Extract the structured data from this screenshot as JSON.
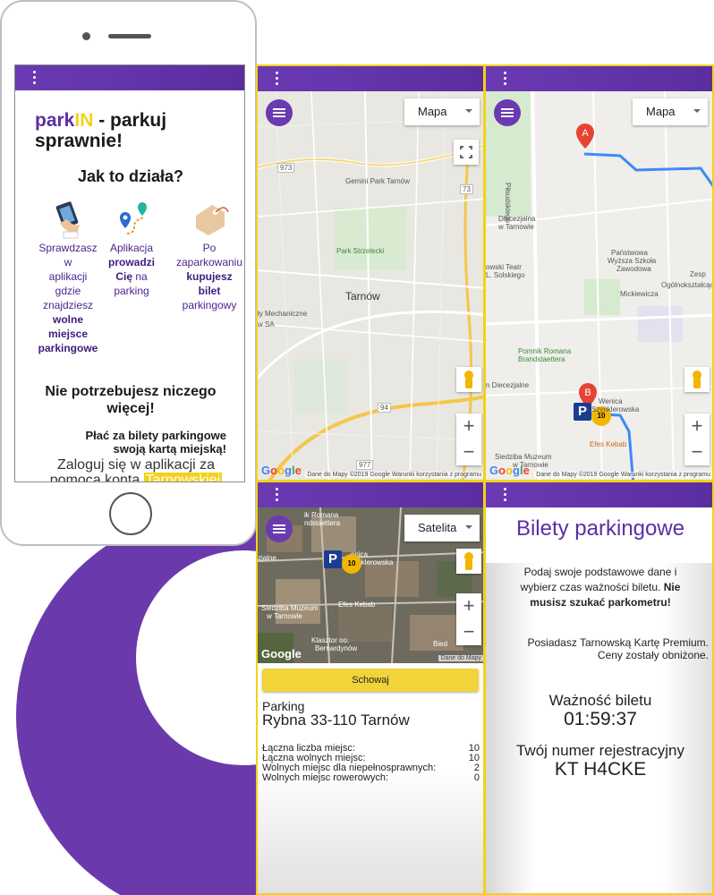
{
  "colors": {
    "brand_purple": "#6a3aad",
    "accent_yellow": "#f2d21b",
    "appbar": "#5b2ea0"
  },
  "phone": {
    "menu_icon": "more-vert-icon",
    "title_part1": "park",
    "title_part2": "IN",
    "title_part3": " - parkuj",
    "title_line2": "sprawnie!",
    "how_title": "Jak to działa?",
    "step1": {
      "line1": "Sprawdzasz",
      "line2": "w",
      "line3": "aplikacji",
      "line4": "gdzie",
      "line5": "znajdziesz",
      "bold1": "wolne",
      "bold2": "miejsce",
      "bold3": "parkingowe"
    },
    "step2": {
      "line1": "Aplikacja",
      "bold1": "prowadzi",
      "bold2": "Cię",
      "line2": " na",
      "line3": "parking"
    },
    "step3": {
      "line1": "Po",
      "line2": "zaparkowaniu",
      "bold1": "kupujesz",
      "bold2": "bilet",
      "line3": "parkingowy"
    },
    "big_msg": "Nie potrzebujesz niczego więcej!",
    "pay_line1": "Płać za bilety parkingowe",
    "pay_line2": "swoją kartą miejską!",
    "login_line1": "Zaloguj się w aplikacji za",
    "login_line2": "pomocą konta ",
    "login_highlight": "Tarnowskiej"
  },
  "map1": {
    "map_type": "Mapa",
    "labels": {
      "park": "Gemini Park Tarnów",
      "strzelecki": "Park Strzelecki",
      "city": "Tarnów",
      "mech": "ły Mechaniczne",
      "sa": "w SA",
      "r973": "973",
      "r73": "73",
      "r94": "94",
      "r977": "977"
    },
    "attribution": "Dane do Mapy ©2019 Google    Warunki korzystania z programu"
  },
  "map2": {
    "map_type": "Mapa",
    "labels": {
      "piasta": "Piłsudskiego",
      "diecezjalna": "Diecezjalna",
      "w_tarnowie": "w Tarnowie",
      "teatr": "owski Teatr",
      "solskiego": "L. Solskiego",
      "szkola1": "Państwowa",
      "szkola2": "Wyższa Szkoła",
      "szkola3": "Zawodowa",
      "pomnik1": "Pomnik Romana",
      "pomnik2": "Brandstaettera",
      "mickiewicza": "Mickiewicza",
      "zesp": "Zesp",
      "ogolno": "Ogólnokształcąc",
      "diecezjalne": "n Diecezjalne",
      "muzeum1": "Siedziba Muzeum",
      "muzeum2": "w Tarnowie",
      "efes": "Efes Kebab",
      "nica": "Wenica",
      "klerowska": "Szynklerowska"
    },
    "marker_a": "A",
    "marker_b": "B",
    "parking_count": "10",
    "attribution": "Dane do Mapy ©2019 Google    Warunki korzystania z programu"
  },
  "map3": {
    "map_type": "Satelita",
    "labels": {
      "pomnik": "ik Romana",
      "brand": "ndstaettera",
      "aleja": "zjalne",
      "nica": "enica",
      "szynk": "Szynklerowska",
      "muzeum1": "Siedziba Muzeum",
      "muzeum2": "w Tarnowie",
      "efes": "Efes Kebab",
      "klasztor": "Klasztor oo.",
      "bernard": "Bernardynów",
      "bied": "Bied"
    },
    "parking_count": "10",
    "attribution": "Dane do Mapy"
  },
  "parking_info": {
    "hide_button": "Schowaj",
    "heading": "Parking",
    "address": "Rybna 33-110 Tarnów",
    "stats": [
      {
        "label": "Łączna liczba miejsc:",
        "value": "10"
      },
      {
        "label": "Łączna wolnych miejsc:",
        "value": "10"
      },
      {
        "label": "Wolnych miejsc dla niepełnosprawnych:",
        "value": "2"
      },
      {
        "label": "Wolnych miejsc rowerowych:",
        "value": "0"
      }
    ]
  },
  "tickets": {
    "title": "Bilety parkingowe",
    "desc_line1": "Podaj swoje podstawowe dane i",
    "desc_line2": "wybierz czas ważności biletu. ",
    "desc_bold1": "Nie",
    "desc_bold2": "musisz szukać parkometru!",
    "premium_line1": "Posiadasz Tarnowską Kartę Premium.",
    "premium_line2": "Ceny zostały obniżone.",
    "validity_label": "Ważność biletu",
    "validity_value": "01:59:37",
    "reg_label": "Twój numer rejestracyjny",
    "reg_value": "KT H4CKE"
  },
  "google_logo": [
    "G",
    "o",
    "o",
    "g",
    "l",
    "e"
  ]
}
